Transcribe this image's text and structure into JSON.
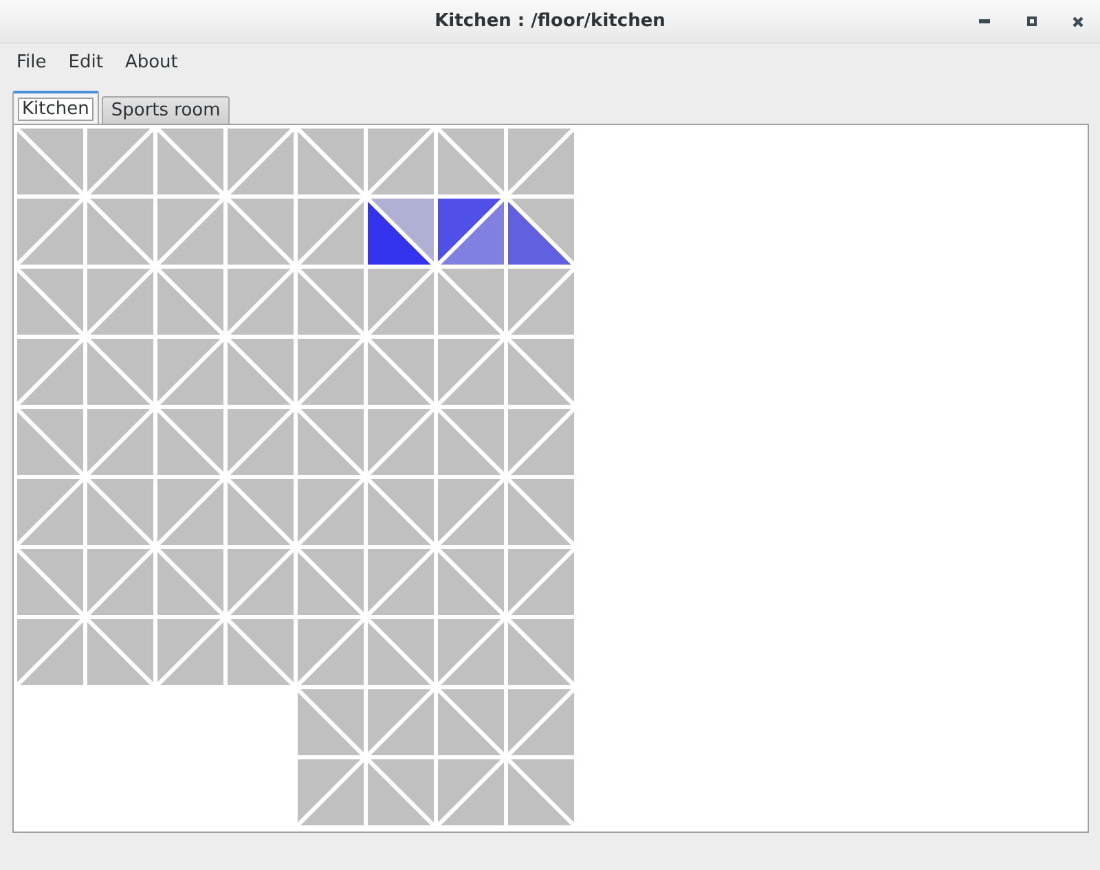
{
  "window": {
    "title": "Kitchen : /floor/kitchen"
  },
  "menu": [
    "File",
    "Edit",
    "About"
  ],
  "tabs": [
    {
      "label": "Kitchen",
      "selected": true
    },
    {
      "label": "Sports room",
      "selected": false
    }
  ],
  "floor": {
    "rows": [
      {
        "cells": [
          {
            "kind": "falling",
            "triangles": [
              {
                "color": "#c0c0c0"
              },
              {
                "color": "#c0c0c0"
              }
            ]
          },
          {
            "kind": "rising",
            "triangles": [
              {
                "color": "#c0c0c0"
              },
              {
                "color": "#c0c0c0"
              }
            ]
          },
          {
            "kind": "falling",
            "triangles": [
              {
                "color": "#c0c0c0"
              },
              {
                "color": "#c0c0c0"
              }
            ]
          },
          {
            "kind": "rising",
            "triangles": [
              {
                "color": "#c0c0c0"
              },
              {
                "color": "#c0c0c0"
              }
            ]
          },
          {
            "kind": "falling",
            "triangles": [
              {
                "color": "#c0c0c0"
              },
              {
                "color": "#c0c0c0"
              }
            ]
          },
          {
            "kind": "rising",
            "triangles": [
              {
                "color": "#c0c0c0"
              },
              {
                "color": "#c0c0c0"
              }
            ]
          },
          {
            "kind": "falling",
            "triangles": [
              {
                "color": "#c0c0c0"
              },
              {
                "color": "#c0c0c0"
              }
            ]
          },
          {
            "kind": "rising",
            "triangles": [
              {
                "color": "#c0c0c0"
              },
              {
                "color": "#c0c0c0"
              }
            ]
          }
        ]
      },
      {
        "cells": [
          {
            "kind": "rising",
            "triangles": [
              {
                "color": "#c0c0c0"
              },
              {
                "color": "#c0c0c0"
              }
            ]
          },
          {
            "kind": "falling",
            "triangles": [
              {
                "color": "#c0c0c0"
              },
              {
                "color": "#c0c0c0"
              }
            ]
          },
          {
            "kind": "rising",
            "triangles": [
              {
                "color": "#c0c0c0"
              },
              {
                "color": "#c0c0c0"
              }
            ]
          },
          {
            "kind": "falling",
            "triangles": [
              {
                "color": "#c0c0c0"
              },
              {
                "color": "#c0c0c0"
              }
            ]
          },
          {
            "kind": "rising",
            "triangles": [
              {
                "color": "#c0c0c0"
              },
              {
                "color": "#c0c0c0"
              }
            ]
          },
          {
            "kind": "falling",
            "triangles": [
              {
                "color": "#3333ee"
              },
              {
                "color": "#b0b0d4"
              }
            ]
          },
          {
            "kind": "rising",
            "triangles": [
              {
                "color": "#5050e8"
              },
              {
                "color": "#8080e0"
              }
            ]
          },
          {
            "kind": "falling",
            "triangles": [
              {
                "color": "#6060e0"
              },
              {
                "color": "#c0c0c0"
              }
            ]
          }
        ]
      },
      {
        "cells": [
          {
            "kind": "falling",
            "triangles": [
              {
                "color": "#c0c0c0"
              },
              {
                "color": "#c0c0c0"
              }
            ]
          },
          {
            "kind": "rising",
            "triangles": [
              {
                "color": "#c0c0c0"
              },
              {
                "color": "#c0c0c0"
              }
            ]
          },
          {
            "kind": "falling",
            "triangles": [
              {
                "color": "#c0c0c0"
              },
              {
                "color": "#c0c0c0"
              }
            ]
          },
          {
            "kind": "rising",
            "triangles": [
              {
                "color": "#c0c0c0"
              },
              {
                "color": "#c0c0c0"
              }
            ]
          },
          {
            "kind": "falling",
            "triangles": [
              {
                "color": "#c0c0c0"
              },
              {
                "color": "#c0c0c0"
              }
            ]
          },
          {
            "kind": "rising",
            "triangles": [
              {
                "color": "#c0c0c0"
              },
              {
                "color": "#c0c0c0"
              }
            ]
          },
          {
            "kind": "falling",
            "triangles": [
              {
                "color": "#c0c0c0"
              },
              {
                "color": "#c0c0c0"
              }
            ]
          },
          {
            "kind": "rising",
            "triangles": [
              {
                "color": "#c0c0c0"
              },
              {
                "color": "#c0c0c0"
              }
            ]
          }
        ]
      },
      {
        "cells": [
          {
            "kind": "rising",
            "triangles": [
              {
                "color": "#c0c0c0"
              },
              {
                "color": "#c0c0c0"
              }
            ]
          },
          {
            "kind": "falling",
            "triangles": [
              {
                "color": "#c0c0c0"
              },
              {
                "color": "#c0c0c0"
              }
            ]
          },
          {
            "kind": "rising",
            "triangles": [
              {
                "color": "#c0c0c0"
              },
              {
                "color": "#c0c0c0"
              }
            ]
          },
          {
            "kind": "falling",
            "triangles": [
              {
                "color": "#c0c0c0"
              },
              {
                "color": "#c0c0c0"
              }
            ]
          },
          {
            "kind": "rising",
            "triangles": [
              {
                "color": "#c0c0c0"
              },
              {
                "color": "#c0c0c0"
              }
            ]
          },
          {
            "kind": "falling",
            "triangles": [
              {
                "color": "#c0c0c0"
              },
              {
                "color": "#c0c0c0"
              }
            ]
          },
          {
            "kind": "rising",
            "triangles": [
              {
                "color": "#c0c0c0"
              },
              {
                "color": "#c0c0c0"
              }
            ]
          },
          {
            "kind": "falling",
            "triangles": [
              {
                "color": "#c0c0c0"
              },
              {
                "color": "#c0c0c0"
              }
            ]
          }
        ]
      },
      {
        "cells": [
          {
            "kind": "falling",
            "triangles": [
              {
                "color": "#c0c0c0"
              },
              {
                "color": "#c0c0c0"
              }
            ]
          },
          {
            "kind": "rising",
            "triangles": [
              {
                "color": "#c0c0c0"
              },
              {
                "color": "#c0c0c0"
              }
            ]
          },
          {
            "kind": "falling",
            "triangles": [
              {
                "color": "#c0c0c0"
              },
              {
                "color": "#c0c0c0"
              }
            ]
          },
          {
            "kind": "rising",
            "triangles": [
              {
                "color": "#c0c0c0"
              },
              {
                "color": "#c0c0c0"
              }
            ]
          },
          {
            "kind": "falling",
            "triangles": [
              {
                "color": "#c0c0c0"
              },
              {
                "color": "#c0c0c0"
              }
            ]
          },
          {
            "kind": "rising",
            "triangles": [
              {
                "color": "#c0c0c0"
              },
              {
                "color": "#c0c0c0"
              }
            ]
          },
          {
            "kind": "falling",
            "triangles": [
              {
                "color": "#c0c0c0"
              },
              {
                "color": "#c0c0c0"
              }
            ]
          },
          {
            "kind": "rising",
            "triangles": [
              {
                "color": "#c0c0c0"
              },
              {
                "color": "#c0c0c0"
              }
            ]
          }
        ]
      },
      {
        "cells": [
          {
            "kind": "rising",
            "triangles": [
              {
                "color": "#c0c0c0"
              },
              {
                "color": "#c0c0c0"
              }
            ]
          },
          {
            "kind": "falling",
            "triangles": [
              {
                "color": "#c0c0c0"
              },
              {
                "color": "#c0c0c0"
              }
            ]
          },
          {
            "kind": "rising",
            "triangles": [
              {
                "color": "#c0c0c0"
              },
              {
                "color": "#c0c0c0"
              }
            ]
          },
          {
            "kind": "falling",
            "triangles": [
              {
                "color": "#c0c0c0"
              },
              {
                "color": "#c0c0c0"
              }
            ]
          },
          {
            "kind": "rising",
            "triangles": [
              {
                "color": "#c0c0c0"
              },
              {
                "color": "#c0c0c0"
              }
            ]
          },
          {
            "kind": "falling",
            "triangles": [
              {
                "color": "#c0c0c0"
              },
              {
                "color": "#c0c0c0"
              }
            ]
          },
          {
            "kind": "rising",
            "triangles": [
              {
                "color": "#c0c0c0"
              },
              {
                "color": "#c0c0c0"
              }
            ]
          },
          {
            "kind": "falling",
            "triangles": [
              {
                "color": "#c0c0c0"
              },
              {
                "color": "#c0c0c0"
              }
            ]
          }
        ]
      },
      {
        "cells": [
          {
            "kind": "falling",
            "triangles": [
              {
                "color": "#c0c0c0"
              },
              {
                "color": "#c0c0c0"
              }
            ]
          },
          {
            "kind": "rising",
            "triangles": [
              {
                "color": "#c0c0c0"
              },
              {
                "color": "#c0c0c0"
              }
            ]
          },
          {
            "kind": "falling",
            "triangles": [
              {
                "color": "#c0c0c0"
              },
              {
                "color": "#c0c0c0"
              }
            ]
          },
          {
            "kind": "rising",
            "triangles": [
              {
                "color": "#c0c0c0"
              },
              {
                "color": "#c0c0c0"
              }
            ]
          },
          {
            "kind": "falling",
            "triangles": [
              {
                "color": "#c0c0c0"
              },
              {
                "color": "#c0c0c0"
              }
            ]
          },
          {
            "kind": "rising",
            "triangles": [
              {
                "color": "#c0c0c0"
              },
              {
                "color": "#c0c0c0"
              }
            ]
          },
          {
            "kind": "falling",
            "triangles": [
              {
                "color": "#c0c0c0"
              },
              {
                "color": "#c0c0c0"
              }
            ]
          },
          {
            "kind": "rising",
            "triangles": [
              {
                "color": "#c0c0c0"
              },
              {
                "color": "#c0c0c0"
              }
            ]
          }
        ]
      },
      {
        "cells": [
          {
            "kind": "rising",
            "triangles": [
              {
                "color": "#c0c0c0"
              },
              {
                "color": "#c0c0c0"
              }
            ]
          },
          {
            "kind": "falling",
            "triangles": [
              {
                "color": "#c0c0c0"
              },
              {
                "color": "#c0c0c0"
              }
            ]
          },
          {
            "kind": "rising",
            "triangles": [
              {
                "color": "#c0c0c0"
              },
              {
                "color": "#c0c0c0"
              }
            ]
          },
          {
            "kind": "falling",
            "triangles": [
              {
                "color": "#c0c0c0"
              },
              {
                "color": "#c0c0c0"
              }
            ]
          },
          {
            "kind": "rising",
            "triangles": [
              {
                "color": "#c0c0c0"
              },
              {
                "color": "#c0c0c0"
              }
            ]
          },
          {
            "kind": "falling",
            "triangles": [
              {
                "color": "#c0c0c0"
              },
              {
                "color": "#c0c0c0"
              }
            ]
          },
          {
            "kind": "rising",
            "triangles": [
              {
                "color": "#c0c0c0"
              },
              {
                "color": "#c0c0c0"
              }
            ]
          },
          {
            "kind": "falling",
            "triangles": [
              {
                "color": "#c0c0c0"
              },
              {
                "color": "#c0c0c0"
              }
            ]
          }
        ]
      },
      {
        "cells": [
          {
            "kind": "empty"
          },
          {
            "kind": "empty"
          },
          {
            "kind": "empty"
          },
          {
            "kind": "empty"
          },
          {
            "kind": "falling",
            "triangles": [
              {
                "color": "#c0c0c0"
              },
              {
                "color": "#c0c0c0"
              }
            ]
          },
          {
            "kind": "rising",
            "triangles": [
              {
                "color": "#c0c0c0"
              },
              {
                "color": "#c0c0c0"
              }
            ]
          },
          {
            "kind": "falling",
            "triangles": [
              {
                "color": "#c0c0c0"
              },
              {
                "color": "#c0c0c0"
              }
            ]
          },
          {
            "kind": "rising",
            "triangles": [
              {
                "color": "#c0c0c0"
              },
              {
                "color": "#c0c0c0"
              }
            ]
          }
        ]
      },
      {
        "cells": [
          {
            "kind": "empty"
          },
          {
            "kind": "empty"
          },
          {
            "kind": "empty"
          },
          {
            "kind": "empty"
          },
          {
            "kind": "rising",
            "triangles": [
              {
                "color": "#c0c0c0"
              },
              {
                "color": "#c0c0c0"
              }
            ]
          },
          {
            "kind": "falling",
            "triangles": [
              {
                "color": "#c0c0c0"
              },
              {
                "color": "#c0c0c0"
              }
            ]
          },
          {
            "kind": "rising",
            "triangles": [
              {
                "color": "#c0c0c0"
              },
              {
                "color": "#c0c0c0"
              }
            ]
          },
          {
            "kind": "falling",
            "triangles": [
              {
                "color": "#c0c0c0"
              },
              {
                "color": "#c0c0c0"
              }
            ]
          }
        ]
      }
    ]
  }
}
